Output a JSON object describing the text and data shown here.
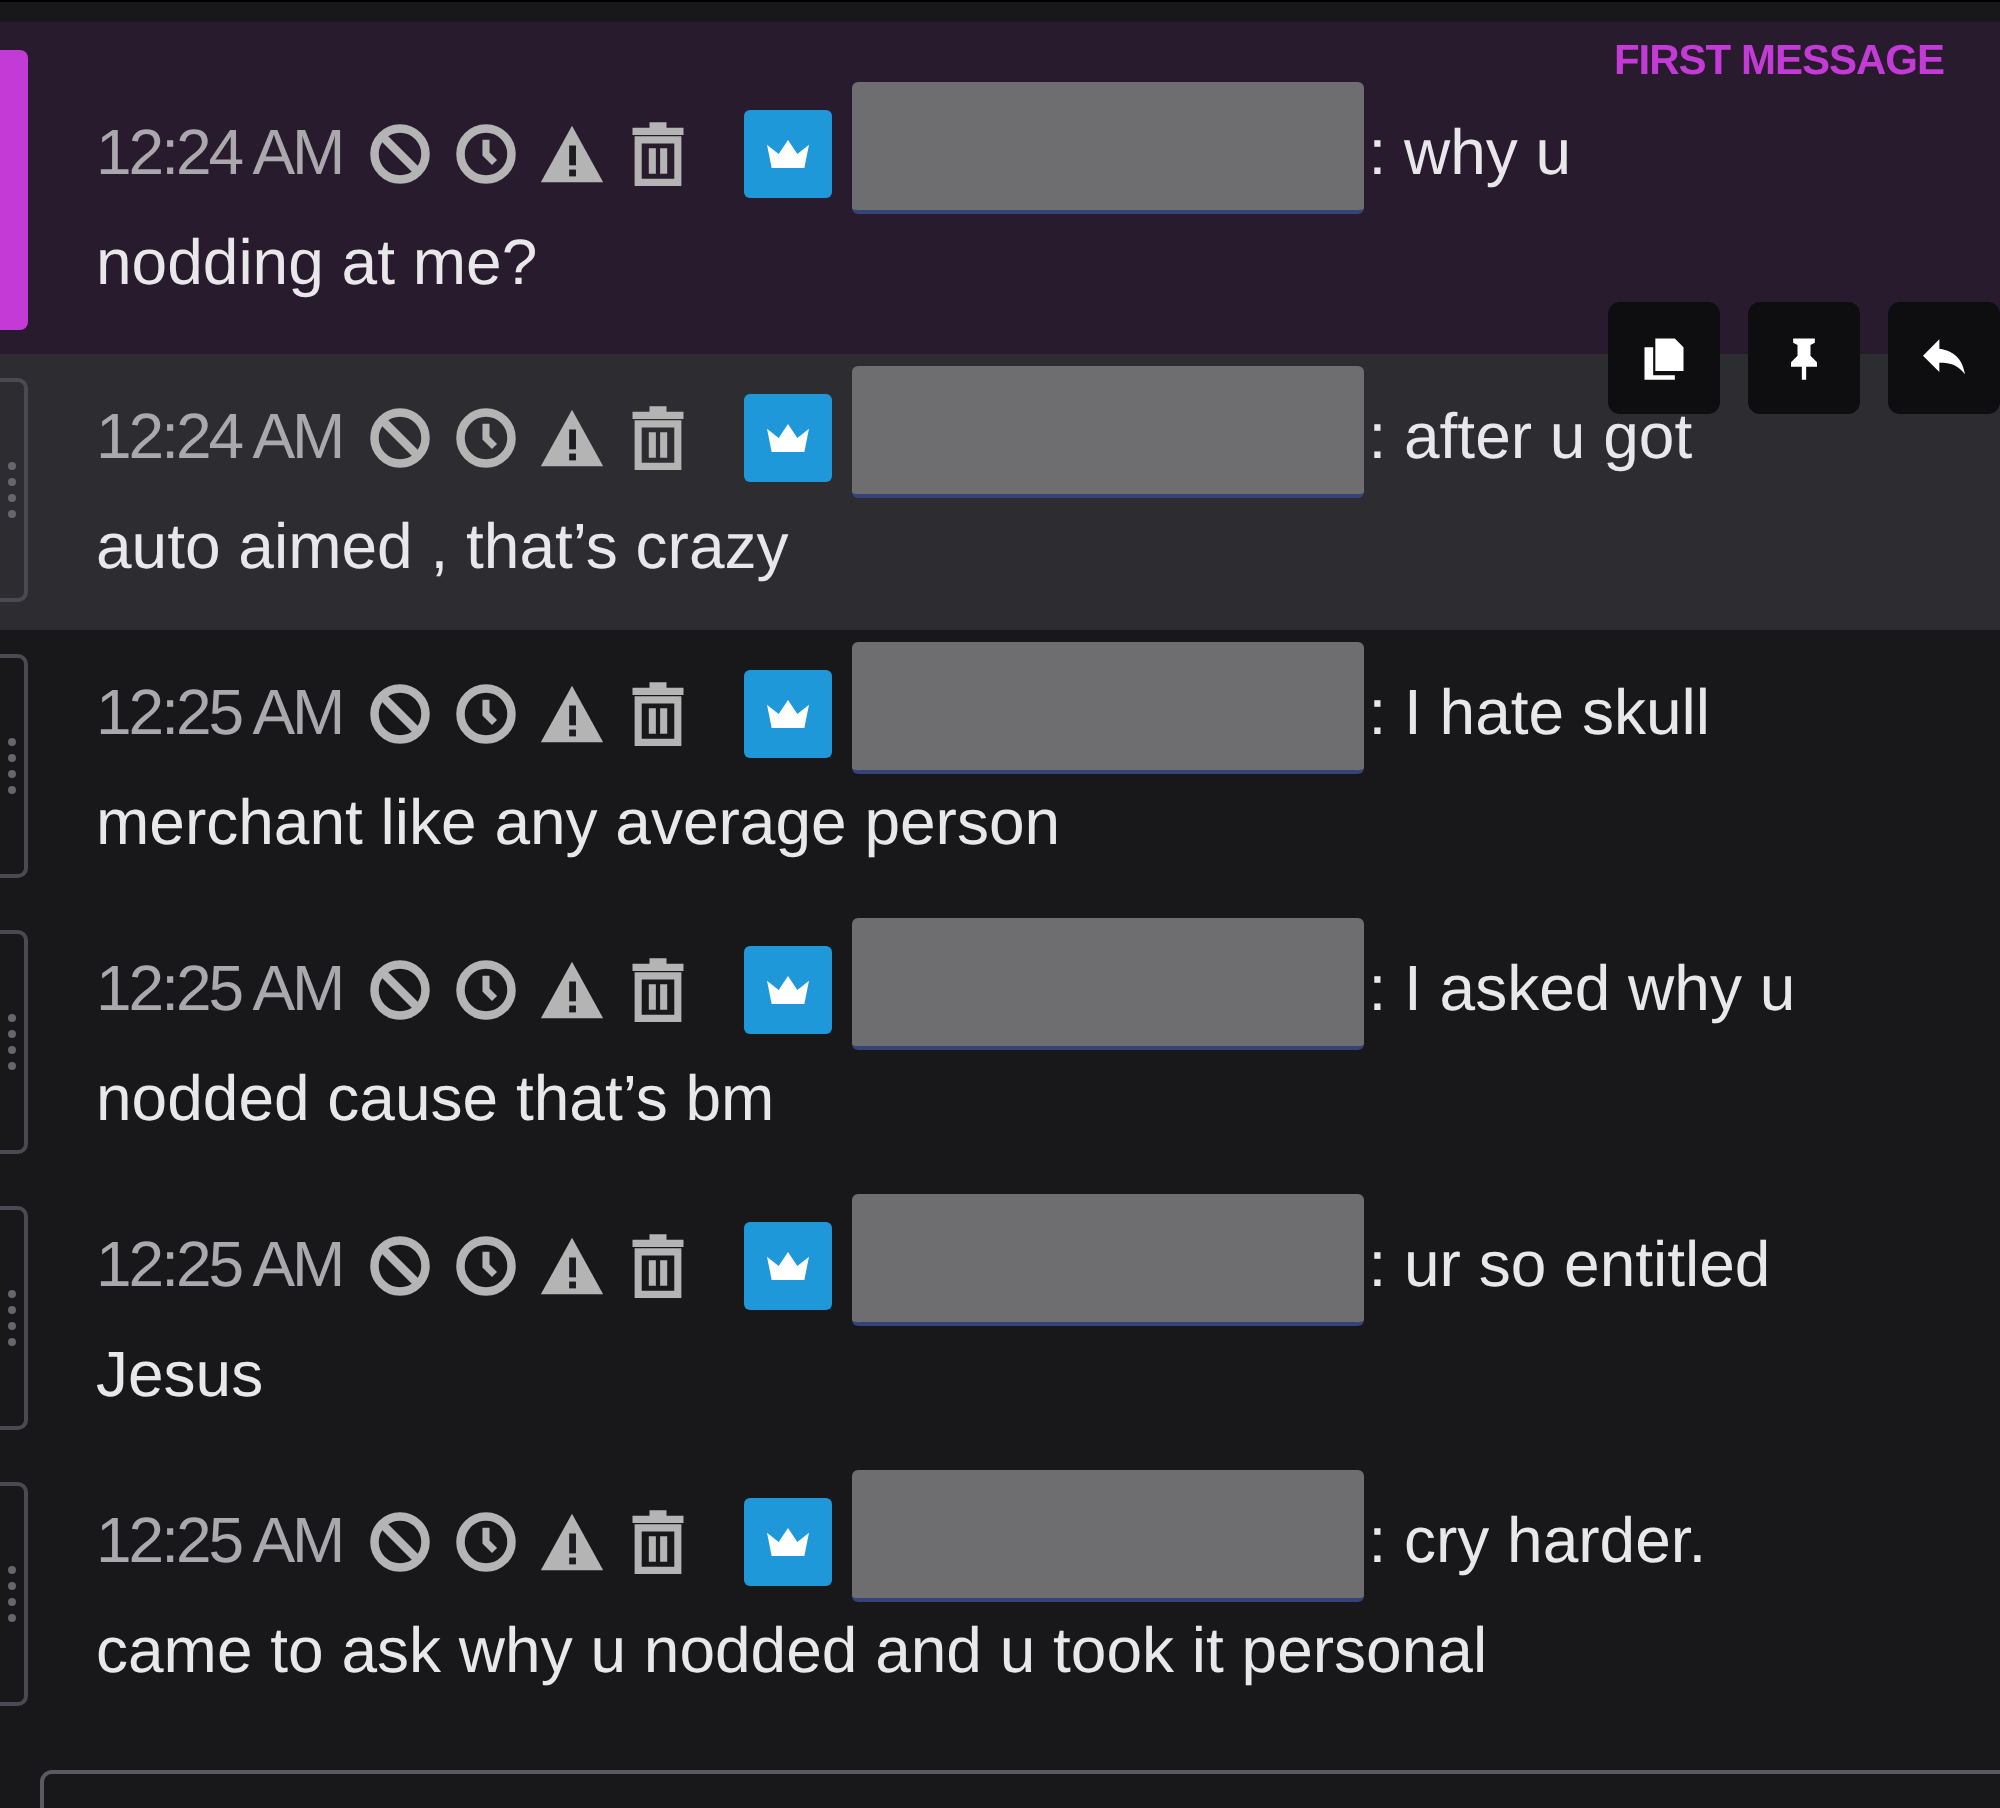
{
  "messages": [
    {
      "kind": "first",
      "hovered": false,
      "badge_label": "FIRST MESSAGE",
      "time": "12:24 AM",
      "redacted": true,
      "text_lines": [
        ": why u",
        "nodding at me?"
      ]
    },
    {
      "kind": "normal",
      "hovered": true,
      "time": "12:24 AM",
      "redacted": true,
      "text_lines": [
        ": after u got",
        "auto aimed , that’s crazy"
      ]
    },
    {
      "kind": "normal",
      "hovered": false,
      "time": "12:25 AM",
      "redacted": true,
      "text_lines": [
        ": I hate skull",
        "merchant like any average person"
      ]
    },
    {
      "kind": "normal",
      "hovered": false,
      "time": "12:25 AM",
      "redacted": true,
      "text_lines": [
        ": I asked why u",
        "nodded cause that’s bm"
      ]
    },
    {
      "kind": "normal",
      "hovered": false,
      "time": "12:25 AM",
      "redacted": true,
      "text_lines": [
        ": ur so entitled",
        "Jesus"
      ]
    },
    {
      "kind": "normal",
      "hovered": false,
      "time": "12:25 AM",
      "redacted": true,
      "text_lines": [
        ": cry harder.",
        "came to ask why u nodded and u took it personal"
      ]
    }
  ]
}
